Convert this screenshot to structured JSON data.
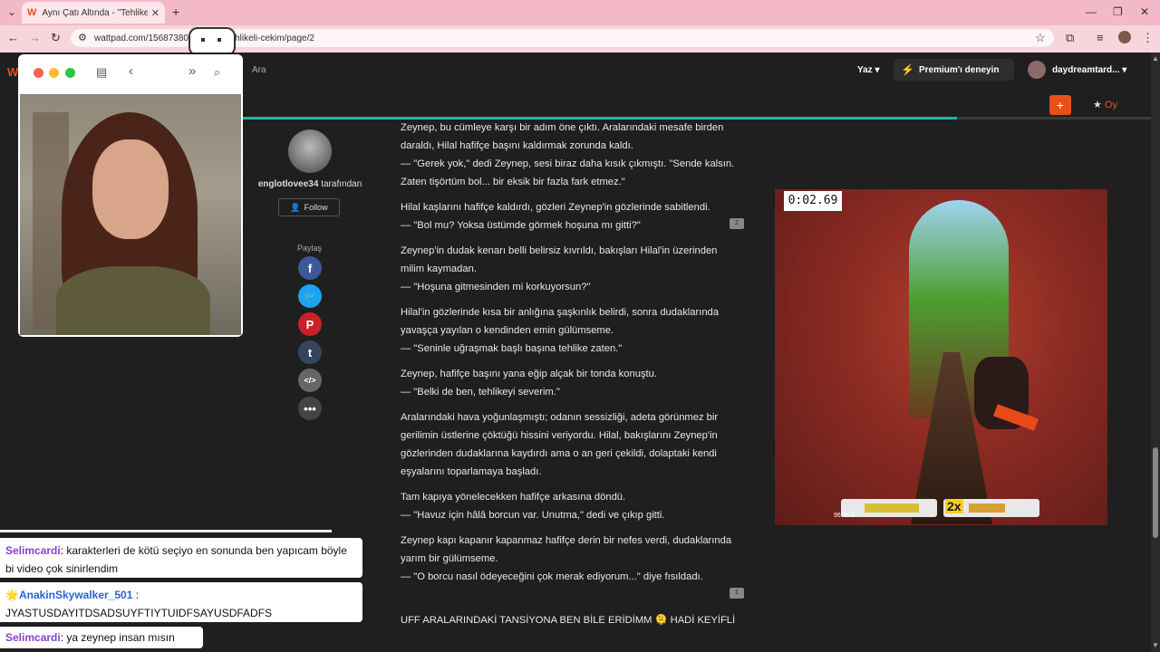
{
  "browser": {
    "tab_title": "Aynı Çatı Altında - \"Tehlikeli çe",
    "tab_logo": "W",
    "url": "wattpad.com/1568738059-...nda-tehlikeli-cekim/page/2",
    "new_tab": "+"
  },
  "header": {
    "search_label": "Ara",
    "write_label": "Yaz",
    "premium_label": "Premium'ı deneyin",
    "username": "daydreamtard...",
    "vote_label": "Oy",
    "add_label": "+"
  },
  "author": {
    "name": "englotlovee34",
    "by_text": "tarafından",
    "follow_label": "Follow",
    "share_label": "Paylaş"
  },
  "story": {
    "p1": "Zeynep, bu cümleye karşı bir adım öne çıktı. Aralarındaki mesafe birden daraldı, Hilal hafifçe başını kaldırmak zorunda kaldı.",
    "p1b": "— \"Gerek yok,\" dedi Zeynep, sesi biraz daha kısık çıkmıştı. \"Sende kalsın. Zaten tişörtüm bol... bir eksik bir fazla fark etmez.\"",
    "p2": "Hilal kaşlarını hafifçe kaldırdı, gözleri Zeynep'in gözlerinde sabitlendi.",
    "p2b": "— \"Bol mu? Yoksa üstümde görmek hoşuna mı gitti?\"",
    "p3": "Zeynep'in dudak kenarı belli belirsiz kıvrıldı, bakışları Hilal'in üzerinden milim kaymadan.",
    "p3b": "— \"Hoşuna gitmesinden mi korkuyorsun?\"",
    "p4": "Hilal'in gözlerinde kısa bir anlığına şaşkınlık belirdi, sonra dudaklarında yavaşça yayılan o kendinden emin gülümseme.",
    "p4b": "— \"Seninle uğraşmak başlı başına tehlike zaten.\"",
    "p5": "Zeynep, hafifçe başını yana eğip alçak bir tonda konuştu.",
    "p5b": "— \"Belki de ben, tehlikeyi severim.\"",
    "p6": "Aralarındaki hava yoğunlaşmıştı; odanın sessizliği, adeta görünmez bir gerilimin üstlerine çöktüğü hissini veriyordu. Hilal, bakışlarını Zeynep'in gözlerinden dudaklarına kaydırdı ama o an geri çekildi, dolaptaki kendi eşyalarını toparlamaya başladı.",
    "p7": "Tam kapıya yönelecekken hafifçe arkasına döndü.",
    "p7b": "— \"Havuz için hâlâ borcun var. Unutma,\" dedi ve çıkıp gitti.",
    "p8": "Zeynep kapı kapanır kapanmaz hafifçe derin bir nefes verdi, dudaklarında yarım bir gülümseme.",
    "p8b": "— \"O borcu nasıl ödeyeceğini çok merak ediyorum...\" diye fısıldadı.",
    "p9": "UFF ARALARINDAKİ TANSİYONA BEN BİLE ERİDİMM 🫠 HADİ KEYİFLİ",
    "comment_count_1": "2",
    "comment_count_2": "1"
  },
  "game": {
    "timer": "0:02.69",
    "multiplier": "2x",
    "score": "965818"
  },
  "chat": [
    {
      "user": "Selimcardi",
      "text": ": karakterleri de kötü seçiyo en sonunda ben yapıcam böyle bi video çok sinirlendim"
    },
    {
      "user": "AnakinSkywalker_501",
      "text": " :",
      "text2": "JYASTUSDAYITDSADSUYFTIYTUIDFSAYUSDFADFS"
    },
    {
      "user": "Selimcardi",
      "text": ": ya zeynep insan mısın"
    }
  ],
  "colors": {
    "accent_teal": "#1eb5a8",
    "brand_orange": "#e8501a",
    "premium_purple": "#e0287a",
    "chat_user": "#8a3fd1"
  }
}
